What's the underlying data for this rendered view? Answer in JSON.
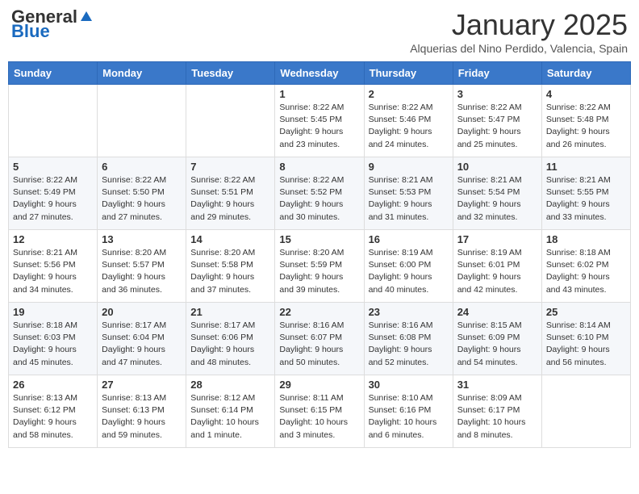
{
  "header": {
    "logo_general": "General",
    "logo_blue": "Blue",
    "month": "January 2025",
    "location": "Alquerias del Nino Perdido, Valencia, Spain"
  },
  "days_of_week": [
    "Sunday",
    "Monday",
    "Tuesday",
    "Wednesday",
    "Thursday",
    "Friday",
    "Saturday"
  ],
  "weeks": [
    [
      {
        "day": "",
        "info": ""
      },
      {
        "day": "",
        "info": ""
      },
      {
        "day": "",
        "info": ""
      },
      {
        "day": "1",
        "info": "Sunrise: 8:22 AM\nSunset: 5:45 PM\nDaylight: 9 hours\nand 23 minutes."
      },
      {
        "day": "2",
        "info": "Sunrise: 8:22 AM\nSunset: 5:46 PM\nDaylight: 9 hours\nand 24 minutes."
      },
      {
        "day": "3",
        "info": "Sunrise: 8:22 AM\nSunset: 5:47 PM\nDaylight: 9 hours\nand 25 minutes."
      },
      {
        "day": "4",
        "info": "Sunrise: 8:22 AM\nSunset: 5:48 PM\nDaylight: 9 hours\nand 26 minutes."
      }
    ],
    [
      {
        "day": "5",
        "info": "Sunrise: 8:22 AM\nSunset: 5:49 PM\nDaylight: 9 hours\nand 27 minutes."
      },
      {
        "day": "6",
        "info": "Sunrise: 8:22 AM\nSunset: 5:50 PM\nDaylight: 9 hours\nand 27 minutes."
      },
      {
        "day": "7",
        "info": "Sunrise: 8:22 AM\nSunset: 5:51 PM\nDaylight: 9 hours\nand 29 minutes."
      },
      {
        "day": "8",
        "info": "Sunrise: 8:22 AM\nSunset: 5:52 PM\nDaylight: 9 hours\nand 30 minutes."
      },
      {
        "day": "9",
        "info": "Sunrise: 8:21 AM\nSunset: 5:53 PM\nDaylight: 9 hours\nand 31 minutes."
      },
      {
        "day": "10",
        "info": "Sunrise: 8:21 AM\nSunset: 5:54 PM\nDaylight: 9 hours\nand 32 minutes."
      },
      {
        "day": "11",
        "info": "Sunrise: 8:21 AM\nSunset: 5:55 PM\nDaylight: 9 hours\nand 33 minutes."
      }
    ],
    [
      {
        "day": "12",
        "info": "Sunrise: 8:21 AM\nSunset: 5:56 PM\nDaylight: 9 hours\nand 34 minutes."
      },
      {
        "day": "13",
        "info": "Sunrise: 8:20 AM\nSunset: 5:57 PM\nDaylight: 9 hours\nand 36 minutes."
      },
      {
        "day": "14",
        "info": "Sunrise: 8:20 AM\nSunset: 5:58 PM\nDaylight: 9 hours\nand 37 minutes."
      },
      {
        "day": "15",
        "info": "Sunrise: 8:20 AM\nSunset: 5:59 PM\nDaylight: 9 hours\nand 39 minutes."
      },
      {
        "day": "16",
        "info": "Sunrise: 8:19 AM\nSunset: 6:00 PM\nDaylight: 9 hours\nand 40 minutes."
      },
      {
        "day": "17",
        "info": "Sunrise: 8:19 AM\nSunset: 6:01 PM\nDaylight: 9 hours\nand 42 minutes."
      },
      {
        "day": "18",
        "info": "Sunrise: 8:18 AM\nSunset: 6:02 PM\nDaylight: 9 hours\nand 43 minutes."
      }
    ],
    [
      {
        "day": "19",
        "info": "Sunrise: 8:18 AM\nSunset: 6:03 PM\nDaylight: 9 hours\nand 45 minutes."
      },
      {
        "day": "20",
        "info": "Sunrise: 8:17 AM\nSunset: 6:04 PM\nDaylight: 9 hours\nand 47 minutes."
      },
      {
        "day": "21",
        "info": "Sunrise: 8:17 AM\nSunset: 6:06 PM\nDaylight: 9 hours\nand 48 minutes."
      },
      {
        "day": "22",
        "info": "Sunrise: 8:16 AM\nSunset: 6:07 PM\nDaylight: 9 hours\nand 50 minutes."
      },
      {
        "day": "23",
        "info": "Sunrise: 8:16 AM\nSunset: 6:08 PM\nDaylight: 9 hours\nand 52 minutes."
      },
      {
        "day": "24",
        "info": "Sunrise: 8:15 AM\nSunset: 6:09 PM\nDaylight: 9 hours\nand 54 minutes."
      },
      {
        "day": "25",
        "info": "Sunrise: 8:14 AM\nSunset: 6:10 PM\nDaylight: 9 hours\nand 56 minutes."
      }
    ],
    [
      {
        "day": "26",
        "info": "Sunrise: 8:13 AM\nSunset: 6:12 PM\nDaylight: 9 hours\nand 58 minutes."
      },
      {
        "day": "27",
        "info": "Sunrise: 8:13 AM\nSunset: 6:13 PM\nDaylight: 9 hours\nand 59 minutes."
      },
      {
        "day": "28",
        "info": "Sunrise: 8:12 AM\nSunset: 6:14 PM\nDaylight: 10 hours\nand 1 minute."
      },
      {
        "day": "29",
        "info": "Sunrise: 8:11 AM\nSunset: 6:15 PM\nDaylight: 10 hours\nand 3 minutes."
      },
      {
        "day": "30",
        "info": "Sunrise: 8:10 AM\nSunset: 6:16 PM\nDaylight: 10 hours\nand 6 minutes."
      },
      {
        "day": "31",
        "info": "Sunrise: 8:09 AM\nSunset: 6:17 PM\nDaylight: 10 hours\nand 8 minutes."
      },
      {
        "day": "",
        "info": ""
      }
    ]
  ]
}
